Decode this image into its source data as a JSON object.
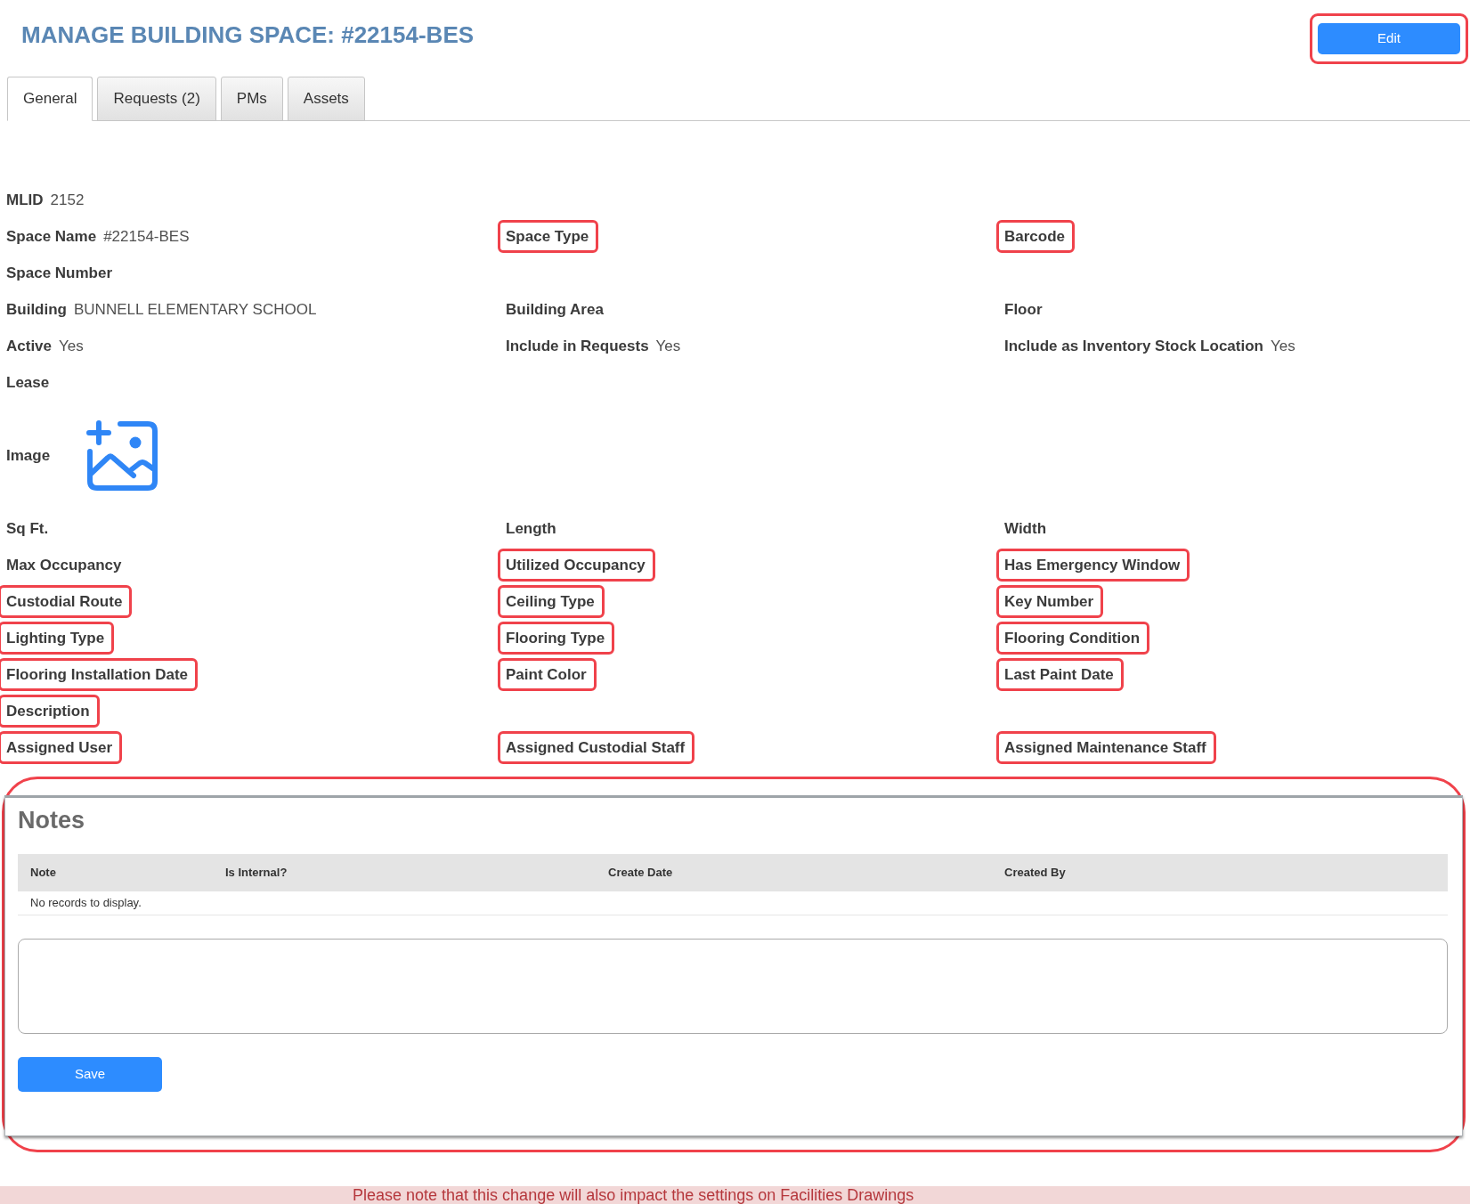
{
  "header": {
    "title": "MANAGE BUILDING SPACE: #22154-BES",
    "edit_button": {
      "label": "Edit",
      "highlighted": true
    }
  },
  "tabs": [
    {
      "label": "General",
      "selected": true
    },
    {
      "label": "Requests (2)",
      "selected": false
    },
    {
      "label": "PMs",
      "selected": false
    },
    {
      "label": "Assets",
      "selected": false
    }
  ],
  "rows": [
    {
      "cells": [
        {
          "kind": "text",
          "label": "MLID",
          "value": "2152",
          "highlighted": false
        }
      ]
    },
    {
      "cells": [
        {
          "kind": "text",
          "label": "Space Name",
          "value": "#22154-BES",
          "highlighted": false
        },
        {
          "kind": "text",
          "label": "Space Type",
          "highlighted": true
        },
        {
          "kind": "text",
          "label": "Barcode",
          "highlighted": true
        }
      ]
    },
    {
      "cells": [
        {
          "kind": "text",
          "label": "Space Number",
          "highlighted": false
        }
      ]
    },
    {
      "cells": [
        {
          "kind": "text",
          "label": "Building",
          "value": "BUNNELL ELEMENTARY SCHOOL",
          "highlighted": false
        },
        {
          "kind": "text",
          "label": "Building Area",
          "highlighted": false
        },
        {
          "kind": "text",
          "label": "Floor",
          "highlighted": false
        }
      ]
    },
    {
      "cells": [
        {
          "kind": "text",
          "label": "Active",
          "value": "Yes",
          "highlighted": false
        },
        {
          "kind": "text",
          "label": "Include in Requests",
          "value": "Yes",
          "highlighted": false
        },
        {
          "kind": "text",
          "label": "Include as Inventory Stock Location",
          "value": "Yes",
          "highlighted": false
        }
      ]
    },
    {
      "cells": [
        {
          "kind": "text",
          "label": "Lease",
          "highlighted": false
        }
      ]
    },
    {
      "cells": [
        {
          "kind": "image",
          "label": "Image",
          "highlighted": false
        }
      ]
    },
    {
      "cells": [
        {
          "kind": "text",
          "label": "Sq Ft.",
          "highlighted": false
        },
        {
          "kind": "text",
          "label": "Length",
          "highlighted": false
        },
        {
          "kind": "text",
          "label": "Width",
          "highlighted": false
        }
      ]
    },
    {
      "cells": [
        {
          "kind": "text",
          "label": "Max Occupancy",
          "highlighted": false
        },
        {
          "kind": "text",
          "label": "Utilized Occupancy",
          "highlighted": true
        },
        {
          "kind": "text",
          "label": "Has Emergency Window",
          "highlighted": true
        }
      ]
    },
    {
      "cells": [
        {
          "kind": "text",
          "label": "Custodial Route",
          "highlighted": true
        },
        {
          "kind": "text",
          "label": "Ceiling Type",
          "highlighted": true
        },
        {
          "kind": "text",
          "label": "Key Number",
          "highlighted": true
        }
      ]
    },
    {
      "cells": [
        {
          "kind": "text",
          "label": "Lighting Type",
          "highlighted": true
        },
        {
          "kind": "text",
          "label": "Flooring Type",
          "highlighted": true
        },
        {
          "kind": "text",
          "label": "Flooring Condition",
          "highlighted": true
        }
      ]
    },
    {
      "cells": [
        {
          "kind": "text",
          "label": "Flooring Installation Date",
          "highlighted": true
        },
        {
          "kind": "text",
          "label": "Paint Color",
          "highlighted": true
        },
        {
          "kind": "text",
          "label": "Last Paint Date",
          "highlighted": true
        }
      ]
    },
    {
      "cells": [
        {
          "kind": "text",
          "label": "Description",
          "highlighted": true
        }
      ]
    },
    {
      "cells": [
        {
          "kind": "text",
          "label": "Assigned User",
          "highlighted": true
        },
        {
          "kind": "text",
          "label": "Assigned Custodial Staff",
          "highlighted": true
        },
        {
          "kind": "text",
          "label": "Assigned Maintenance Staff",
          "highlighted": true
        }
      ]
    }
  ],
  "notes": {
    "title": "Notes",
    "highlighted": true,
    "table": {
      "columns": [
        "Note",
        "Is Internal?",
        "Create Date",
        "Created By"
      ],
      "empty_message": "No records to display."
    },
    "save_button": "Save"
  },
  "notice": "Please note that this change will also impact the settings on Facilities Drawings"
}
